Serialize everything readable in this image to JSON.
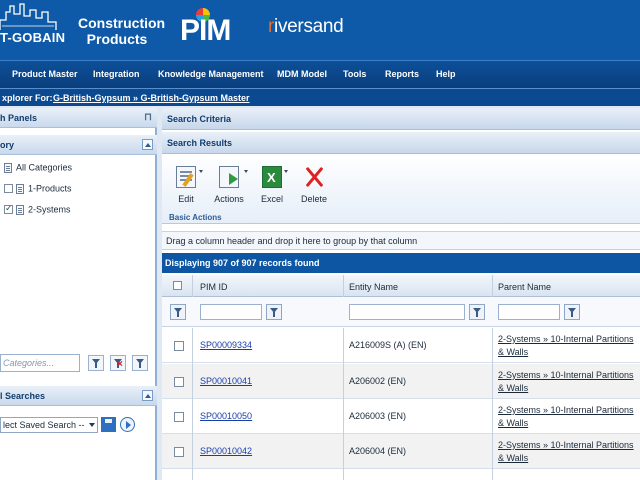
{
  "header": {
    "brand": "T-GOBAIN",
    "product_line": "Construction Products",
    "app_name": "PIM",
    "vendor_prefix": "r",
    "vendor_rest": "iversand"
  },
  "menu": {
    "items": [
      "Product Master",
      "Integration",
      "Knowledge Management",
      "MDM Model",
      "Tools",
      "Reports",
      "Help"
    ]
  },
  "breadcrumb": {
    "label": "xplorer For:",
    "path": "G-British-Gypsum » G-British-Gypsum Master"
  },
  "left_panel": {
    "title": "h Panels",
    "category_title": "ory",
    "tree": [
      {
        "label": "All Categories",
        "checkbox": false
      },
      {
        "label": "1-Products",
        "checkbox": true,
        "checked": false
      },
      {
        "label": "2-Systems",
        "checkbox": true,
        "checked": true
      }
    ],
    "category_search_placeholder": "Categories...",
    "saved_searches_title": "l Searches",
    "saved_search_value": "lect Saved Search --"
  },
  "right_panel": {
    "search_criteria": "Search Criteria",
    "search_results": "Search Results",
    "toolbar": {
      "edit": "Edit",
      "actions": "Actions",
      "excel": "Excel",
      "delete": "Delete",
      "group_label": "Basic Actions"
    },
    "group_hint": "Drag a column header and drop it here to group by that column",
    "record_count": "Displaying 907 of 907 records found",
    "columns": [
      "PIM ID",
      "Entity Name",
      "Parent Name"
    ],
    "rows": [
      {
        "pim_id": "SP00009334",
        "entity_name": "A216009S (A) (EN)",
        "parent_name": "2-Systems » 10-Internal Partitions & Walls"
      },
      {
        "pim_id": "SP00010041",
        "entity_name": "A206002 (EN)",
        "parent_name": "2-Systems » 10-Internal Partitions & Walls"
      },
      {
        "pim_id": "SP00010050",
        "entity_name": "A206003 (EN)",
        "parent_name": "2-Systems » 10-Internal Partitions & Walls"
      },
      {
        "pim_id": "SP00010042",
        "entity_name": "A206004 (EN)",
        "parent_name": "2-Systems » 10-Internal Partitions & Walls"
      }
    ]
  }
}
